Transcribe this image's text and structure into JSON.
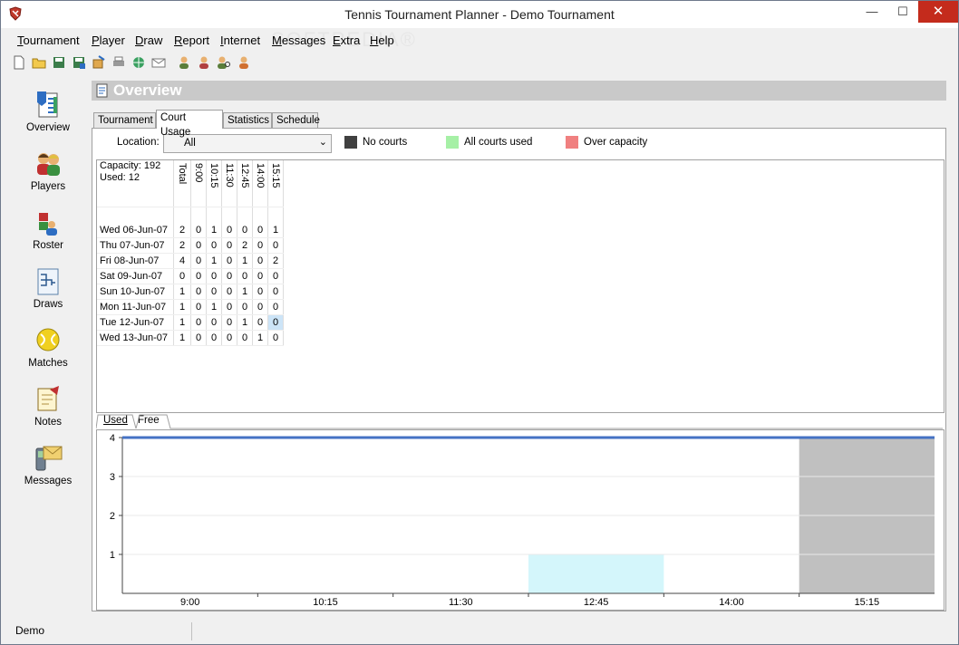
{
  "window": {
    "title": "Tennis Tournament Planner - Demo Tournament",
    "min_glyph": "—",
    "max_glyph": "☐",
    "close_glyph": "✕"
  },
  "menu": [
    {
      "first": "T",
      "rest": "ournament"
    },
    {
      "first": "P",
      "rest": "layer"
    },
    {
      "first": "D",
      "rest": "raw"
    },
    {
      "first": "R",
      "rest": "eport"
    },
    {
      "first": "I",
      "rest": "nternet"
    },
    {
      "first": "M",
      "rest": "essages"
    },
    {
      "first": "E",
      "rest": "xtra"
    },
    {
      "first": "H",
      "rest": "elp"
    }
  ],
  "watermark": "SOFTPEDIA®",
  "nav": [
    {
      "label": "Overview",
      "icon": "overview-icon"
    },
    {
      "label": "Players",
      "icon": "players-icon"
    },
    {
      "label": "Roster",
      "icon": "roster-icon"
    },
    {
      "label": "Draws",
      "icon": "draws-icon"
    },
    {
      "label": "Matches",
      "icon": "matches-icon"
    },
    {
      "label": "Notes",
      "icon": "notes-icon"
    },
    {
      "label": "Messages",
      "icon": "messages-icon"
    }
  ],
  "overview": {
    "title": "Overview",
    "tabs": [
      "Tournament",
      "Court Usage",
      "Statistics",
      "Schedule"
    ],
    "active_tab": "Court Usage"
  },
  "court_usage": {
    "location_label": "Location:",
    "location_value": "All",
    "legend": [
      {
        "label": "No courts",
        "color": "#404040"
      },
      {
        "label": "All courts used",
        "color": "#a6f0a6"
      },
      {
        "label": "Over capacity",
        "color": "#f08080"
      }
    ],
    "capacity_text": "Capacity: 192",
    "used_text": "Used: 12",
    "columns": [
      "Total",
      "9:00",
      "10:15",
      "11:30",
      "12:45",
      "14:00",
      "15:15"
    ],
    "rows": [
      {
        "date": "Wed 06-Jun-07",
        "values": [
          "2",
          "0",
          "1",
          "0",
          "0",
          "0",
          "1"
        ]
      },
      {
        "date": "Thu 07-Jun-07",
        "values": [
          "2",
          "0",
          "0",
          "0",
          "2",
          "0",
          "0"
        ]
      },
      {
        "date": "Fri 08-Jun-07",
        "values": [
          "4",
          "0",
          "1",
          "0",
          "1",
          "0",
          "2"
        ]
      },
      {
        "date": "Sat 09-Jun-07",
        "values": [
          "0",
          "0",
          "0",
          "0",
          "0",
          "0",
          "0"
        ]
      },
      {
        "date": "Sun 10-Jun-07",
        "values": [
          "1",
          "0",
          "0",
          "0",
          "1",
          "0",
          "0"
        ]
      },
      {
        "date": "Mon 11-Jun-07",
        "values": [
          "1",
          "0",
          "1",
          "0",
          "0",
          "0",
          "0"
        ]
      },
      {
        "date": "Tue 12-Jun-07",
        "values": [
          "1",
          "0",
          "0",
          "0",
          "1",
          "0",
          "0"
        ]
      },
      {
        "date": "Wed 13-Jun-07",
        "values": [
          "1",
          "0",
          "0",
          "0",
          "0",
          "1",
          "0"
        ]
      }
    ],
    "selected_cell": {
      "row": 6,
      "col": 6
    },
    "subtabs": [
      "Used",
      "Free"
    ],
    "active_subtab": "Used"
  },
  "chart_data": {
    "type": "area",
    "x": [
      "9:00",
      "10:15",
      "11:30",
      "12:45",
      "14:00",
      "15:15"
    ],
    "ylim": [
      0,
      4
    ],
    "yticks": [
      "1",
      "2",
      "3",
      "4"
    ],
    "capacity_line": 4,
    "series": [
      {
        "values": [
          0,
          0,
          0,
          1,
          0,
          4
        ],
        "colors": [
          "#ffffff",
          "#ffffff",
          "#ffffff",
          "#d4f6fb",
          "#ffffff",
          "#c0c0c0"
        ]
      }
    ],
    "grid": true
  },
  "status": {
    "text": "Demo"
  }
}
